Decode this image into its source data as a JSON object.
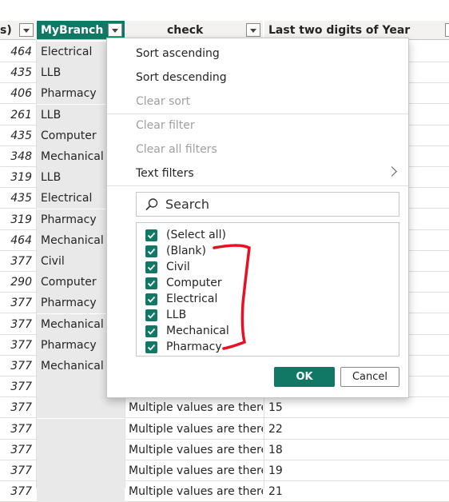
{
  "headers": {
    "prev_col": "s)",
    "branch": "MyBranch",
    "check": "check",
    "year": "Last two digits of Year column"
  },
  "rows": [
    {
      "num": "464",
      "branch": "Electrical",
      "check": "",
      "year": ""
    },
    {
      "num": "435",
      "branch": "LLB",
      "check": "",
      "year": ""
    },
    {
      "num": "406",
      "branch": "Pharmacy",
      "check": "",
      "year": ""
    },
    {
      "num": "261",
      "branch": "LLB",
      "check": "",
      "year": ""
    },
    {
      "num": "435",
      "branch": "Computer",
      "check": "",
      "year": ""
    },
    {
      "num": "348",
      "branch": "Mechanical",
      "check": "",
      "year": ""
    },
    {
      "num": "319",
      "branch": "LLB",
      "check": "",
      "year": ""
    },
    {
      "num": "435",
      "branch": "Electrical",
      "check": "",
      "year": ""
    },
    {
      "num": "319",
      "branch": "Pharmacy",
      "check": "",
      "year": ""
    },
    {
      "num": "464",
      "branch": "Mechanical",
      "check": "",
      "year": ""
    },
    {
      "num": "377",
      "branch": "Civil",
      "check": "",
      "year": ""
    },
    {
      "num": "290",
      "branch": "Computer",
      "check": "",
      "year": ""
    },
    {
      "num": "377",
      "branch": "Pharmacy",
      "check": "",
      "year": ""
    },
    {
      "num": "377",
      "branch": "Mechanical",
      "check": "",
      "year": ""
    },
    {
      "num": "377",
      "branch": "Pharmacy",
      "check": "",
      "year": ""
    },
    {
      "num": "377",
      "branch": "Mechanical",
      "check": "",
      "year": ""
    },
    {
      "num": "377",
      "branch": "",
      "check": "",
      "year": ""
    },
    {
      "num": "377",
      "branch": "",
      "check": "Multiple values are there",
      "year": "15"
    },
    {
      "num": "377",
      "branch": "",
      "check": "Multiple values are there",
      "year": "22"
    },
    {
      "num": "377",
      "branch": "",
      "check": "Multiple values are there",
      "year": "18"
    },
    {
      "num": "377",
      "branch": "",
      "check": "Multiple values are there",
      "year": "19"
    },
    {
      "num": "377",
      "branch": "",
      "check": "Multiple values are there",
      "year": "21"
    }
  ],
  "menu": {
    "sort_asc": "Sort ascending",
    "sort_desc": "Sort descending",
    "clear_sort": "Clear sort",
    "clear_filter": "Clear filter",
    "clear_all_filters": "Clear all filters",
    "text_filters": "Text filters",
    "search_placeholder": "Search",
    "options": [
      "(Select all)",
      "(Blank)",
      "Civil",
      "Computer",
      "Electrical",
      "LLB",
      "Mechanical",
      "Pharmacy"
    ],
    "ok": "OK",
    "cancel": "Cancel"
  },
  "colors": {
    "accent": "#117865",
    "annotation": "#e81123"
  }
}
